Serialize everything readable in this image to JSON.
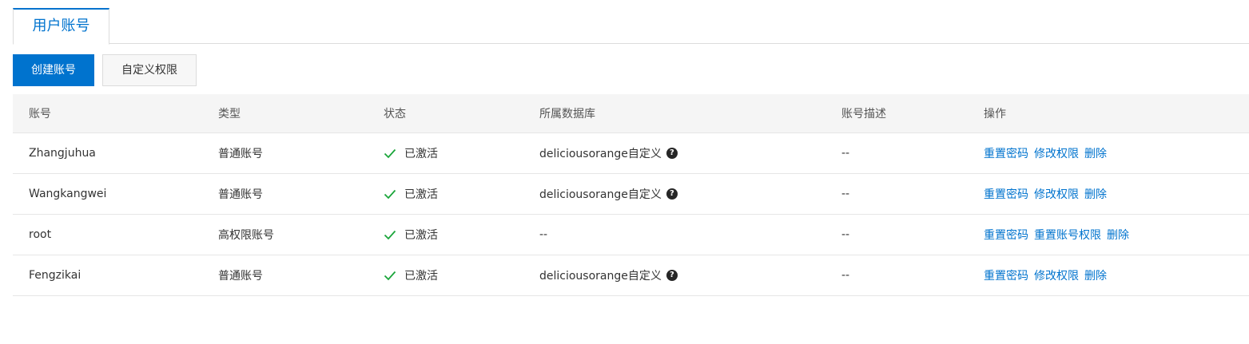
{
  "tabs": [
    {
      "label": "用户账号",
      "active": true
    }
  ],
  "toolbar": {
    "create_label": "创建账号",
    "custom_perm_label": "自定义权限"
  },
  "colors": {
    "primary": "#0073ce",
    "success": "#1aa53a",
    "header_bg": "#f5f5f5"
  },
  "table": {
    "headers": {
      "account": "账号",
      "type": "类型",
      "status": "状态",
      "database": "所属数据库",
      "description": "账号描述",
      "actions": "操作"
    },
    "rows": [
      {
        "account": "Zhangjuhua",
        "type": "普通账号",
        "status": "已激活",
        "database": "deliciousorange自定义",
        "has_help_icon": true,
        "description": "--",
        "actions": [
          "重置密码",
          "修改权限",
          "删除"
        ]
      },
      {
        "account": "Wangkangwei",
        "type": "普通账号",
        "status": "已激活",
        "database": "deliciousorange自定义",
        "has_help_icon": true,
        "description": "--",
        "actions": [
          "重置密码",
          "修改权限",
          "删除"
        ]
      },
      {
        "account": "root",
        "type": "高权限账号",
        "status": "已激活",
        "database": "--",
        "has_help_icon": false,
        "description": "--",
        "actions": [
          "重置密码",
          "重置账号权限",
          "删除"
        ]
      },
      {
        "account": "Fengzikai",
        "type": "普通账号",
        "status": "已激活",
        "database": "deliciousorange自定义",
        "has_help_icon": true,
        "description": "--",
        "actions": [
          "重置密码",
          "修改权限",
          "删除"
        ]
      }
    ]
  }
}
